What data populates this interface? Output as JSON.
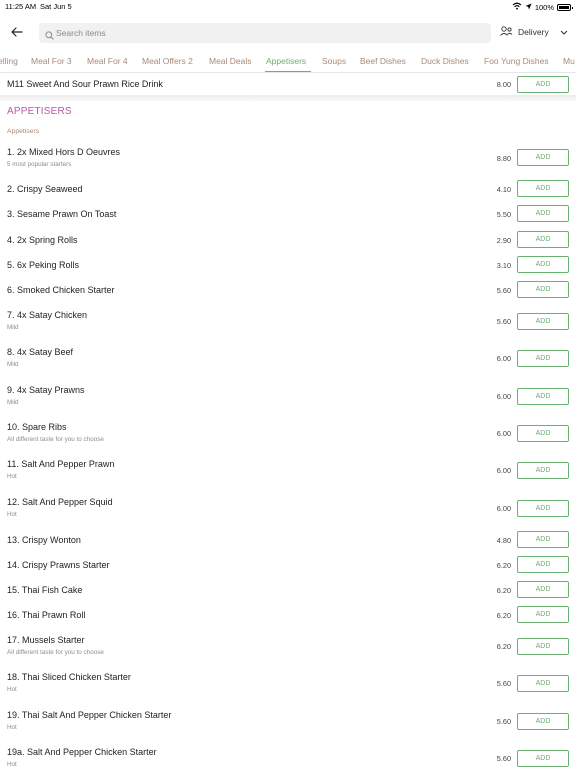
{
  "status_bar": {
    "time": "11:25 AM",
    "date": "Sat Jun 5",
    "battery": "100%"
  },
  "search": {
    "placeholder": "Search items"
  },
  "delivery": {
    "label": "Delivery"
  },
  "tabs": [
    {
      "label": "elling",
      "active": false
    },
    {
      "label": "Meal For 3",
      "active": false
    },
    {
      "label": "Meal For 4",
      "active": false
    },
    {
      "label": "Meal Offers 2",
      "active": false
    },
    {
      "label": "Meal Deals",
      "active": false
    },
    {
      "label": "Appetisers",
      "active": true
    },
    {
      "label": "Soups",
      "active": false
    },
    {
      "label": "Beef Dishes",
      "active": false
    },
    {
      "label": "Duck Dishes",
      "active": false
    },
    {
      "label": "Foo Yung Dishes",
      "active": false
    },
    {
      "label": "Mu",
      "active": false
    }
  ],
  "top_item": {
    "name": "M11 Sweet And Sour Prawn Rice Drink",
    "price": "8.00",
    "add_label": "ADD"
  },
  "section": {
    "title": "APPETISERS",
    "subtitle": "Appetisers"
  },
  "items": [
    {
      "name": "1. 2x Mixed Hors D Oeuvres",
      "desc": "5 most popular starters",
      "price": "8.80",
      "add_label": "ADD"
    },
    {
      "name": "2. Crispy Seaweed",
      "desc": "",
      "price": "4.10",
      "add_label": "ADD"
    },
    {
      "name": "3. Sesame Prawn On Toast",
      "desc": "",
      "price": "5.50",
      "add_label": "ADD"
    },
    {
      "name": "4. 2x Spring Rolls",
      "desc": "",
      "price": "2.90",
      "add_label": "ADD"
    },
    {
      "name": "5. 6x Peking Rolls",
      "desc": "",
      "price": "3.10",
      "add_label": "ADD"
    },
    {
      "name": "6. Smoked Chicken Starter",
      "desc": "",
      "price": "5.60",
      "add_label": "ADD"
    },
    {
      "name": "7. 4x Satay Chicken",
      "desc": "Mild",
      "price": "5.60",
      "add_label": "ADD"
    },
    {
      "name": "8. 4x Satay Beef",
      "desc": "Mild",
      "price": "6.00",
      "add_label": "ADD"
    },
    {
      "name": "9. 4x Satay Prawns",
      "desc": "Mild",
      "price": "6.00",
      "add_label": "ADD"
    },
    {
      "name": "10. Spare Ribs",
      "desc": "All different taste for you to choose",
      "price": "6.00",
      "add_label": "ADD"
    },
    {
      "name": "11. Salt And Pepper Prawn",
      "desc": "Hot",
      "price": "6.00",
      "add_label": "ADD"
    },
    {
      "name": "12. Salt And Pepper Squid",
      "desc": "Hot",
      "price": "6.00",
      "add_label": "ADD"
    },
    {
      "name": "13. Crispy Wonton",
      "desc": "",
      "price": "4.80",
      "add_label": "ADD"
    },
    {
      "name": "14. Crispy Prawns Starter",
      "desc": "",
      "price": "6.20",
      "add_label": "ADD"
    },
    {
      "name": "15. Thai Fish Cake",
      "desc": "",
      "price": "6.20",
      "add_label": "ADD"
    },
    {
      "name": "16. Thai Prawn Roll",
      "desc": "",
      "price": "6.20",
      "add_label": "ADD"
    },
    {
      "name": "17. Mussels Starter",
      "desc": "All different taste for you to choose",
      "price": "6.20",
      "add_label": "ADD"
    },
    {
      "name": "18. Thai Sliced Chicken Starter",
      "desc": "Hot",
      "price": "5.60",
      "add_label": "ADD"
    },
    {
      "name": "19. Thai Salt And Pepper Chicken Starter",
      "desc": "Hot",
      "price": "5.60",
      "add_label": "ADD"
    },
    {
      "name": "19a. Salt And Pepper Chicken Starter",
      "desc": "Hot",
      "price": "5.60",
      "add_label": "ADD"
    }
  ],
  "colors": {
    "accent": "#6ab06e",
    "section_title": "#b75aa8",
    "tab_text": "#a88a79"
  }
}
